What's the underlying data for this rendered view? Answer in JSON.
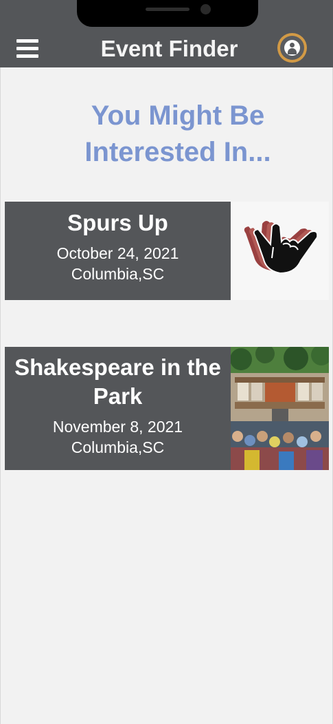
{
  "header": {
    "title": "Event Finder",
    "menu_icon": "hamburger-menu-icon",
    "profile_icon": "user-profile-icon",
    "accent_color": "#d29a46"
  },
  "headline": "You Might Be Interested In...",
  "events": [
    {
      "title": "Spurs Up",
      "date": "October 24, 2021",
      "location": "Columbia,SC",
      "image": "spurs-up-hand-sign"
    },
    {
      "title": "Shakespeare in the Park",
      "date": "November 8, 2021",
      "location": "Columbia,SC",
      "image": "outdoor-theater-stage-crowd"
    }
  ]
}
